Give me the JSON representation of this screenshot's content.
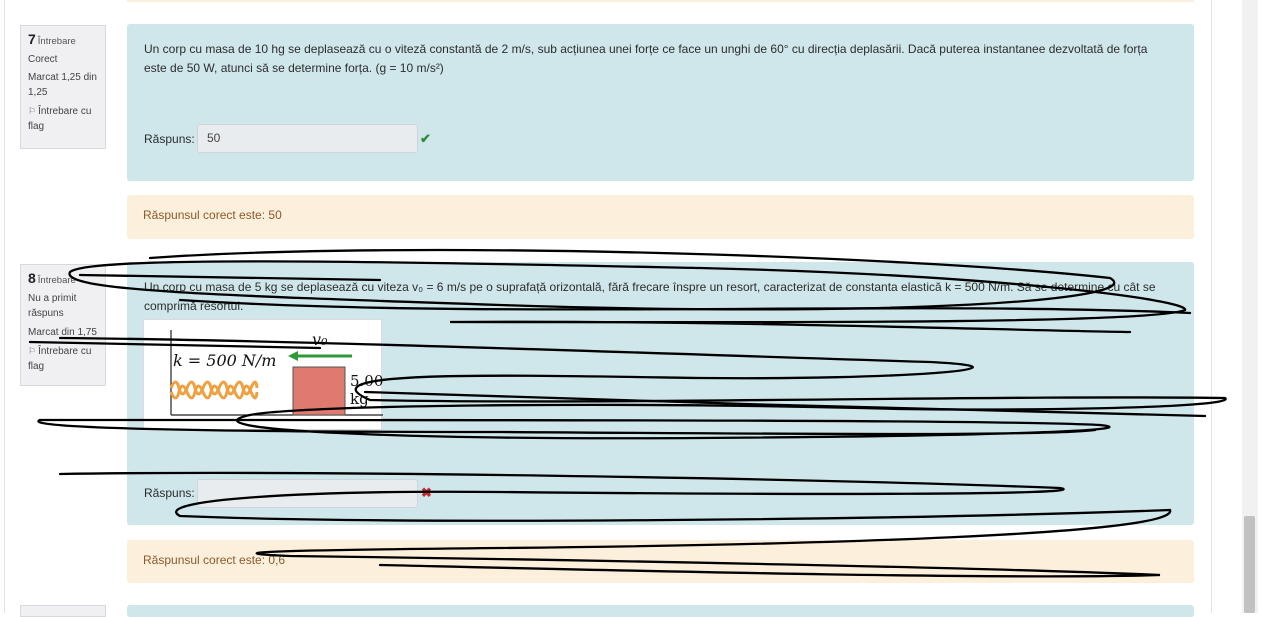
{
  "q7": {
    "number": "7",
    "word": "Întrebare",
    "status": "Corect",
    "mark": "Marcat 1,25 din 1,25",
    "flag_label": "Întrebare cu flag",
    "text_line1": "Un corp cu masa de 10 hg se deplasează cu o viteză constantă de 2 m/s, sub acțiunea unei forțe ce face un unghi de 60° cu direcția deplasării. Dacă puterea instantanee dezvoltată de forța",
    "text_line2": "este de 50 W, atunci să se determine forța. (g = 10 m/s²)",
    "answer_label": "Răspuns:",
    "answer_value": "50",
    "feedback": "Răspunsul corect este: 50"
  },
  "q8": {
    "number": "8",
    "word": "Întrebare",
    "status": "Nu a primit răspuns",
    "mark": "Marcat din 1,75",
    "flag_label": "Întrebare cu flag",
    "text_line1": "Un corp cu masa de 5 kg se deplasează cu viteza v₀ = 6 m/s pe o suprafață orizontală, fără frecare înspre un resort, caracterizat de constanta elastică k = 500 N/m. Să se determine cu cât se",
    "text_line2": "comprimă resortul.",
    "figure": {
      "k_label": "k = 500 N/m",
      "v_label": "v₀",
      "mass_value": "5.00",
      "mass_unit": "kg"
    },
    "answer_label": "Răspuns:",
    "answer_value": "",
    "feedback": "Răspunsul corect este: 0,6"
  },
  "icons": {
    "correct": "check-icon",
    "incorrect": "cross-icon",
    "flag": "flag-icon"
  },
  "colors": {
    "question_bg": "#cfe6ea",
    "feedback_bg": "#fcefdc",
    "correct": "#2e8b3a",
    "incorrect": "#c62828",
    "spring": "#f0a040",
    "block": "#e07a6e",
    "arrow": "#2e9a3a"
  }
}
